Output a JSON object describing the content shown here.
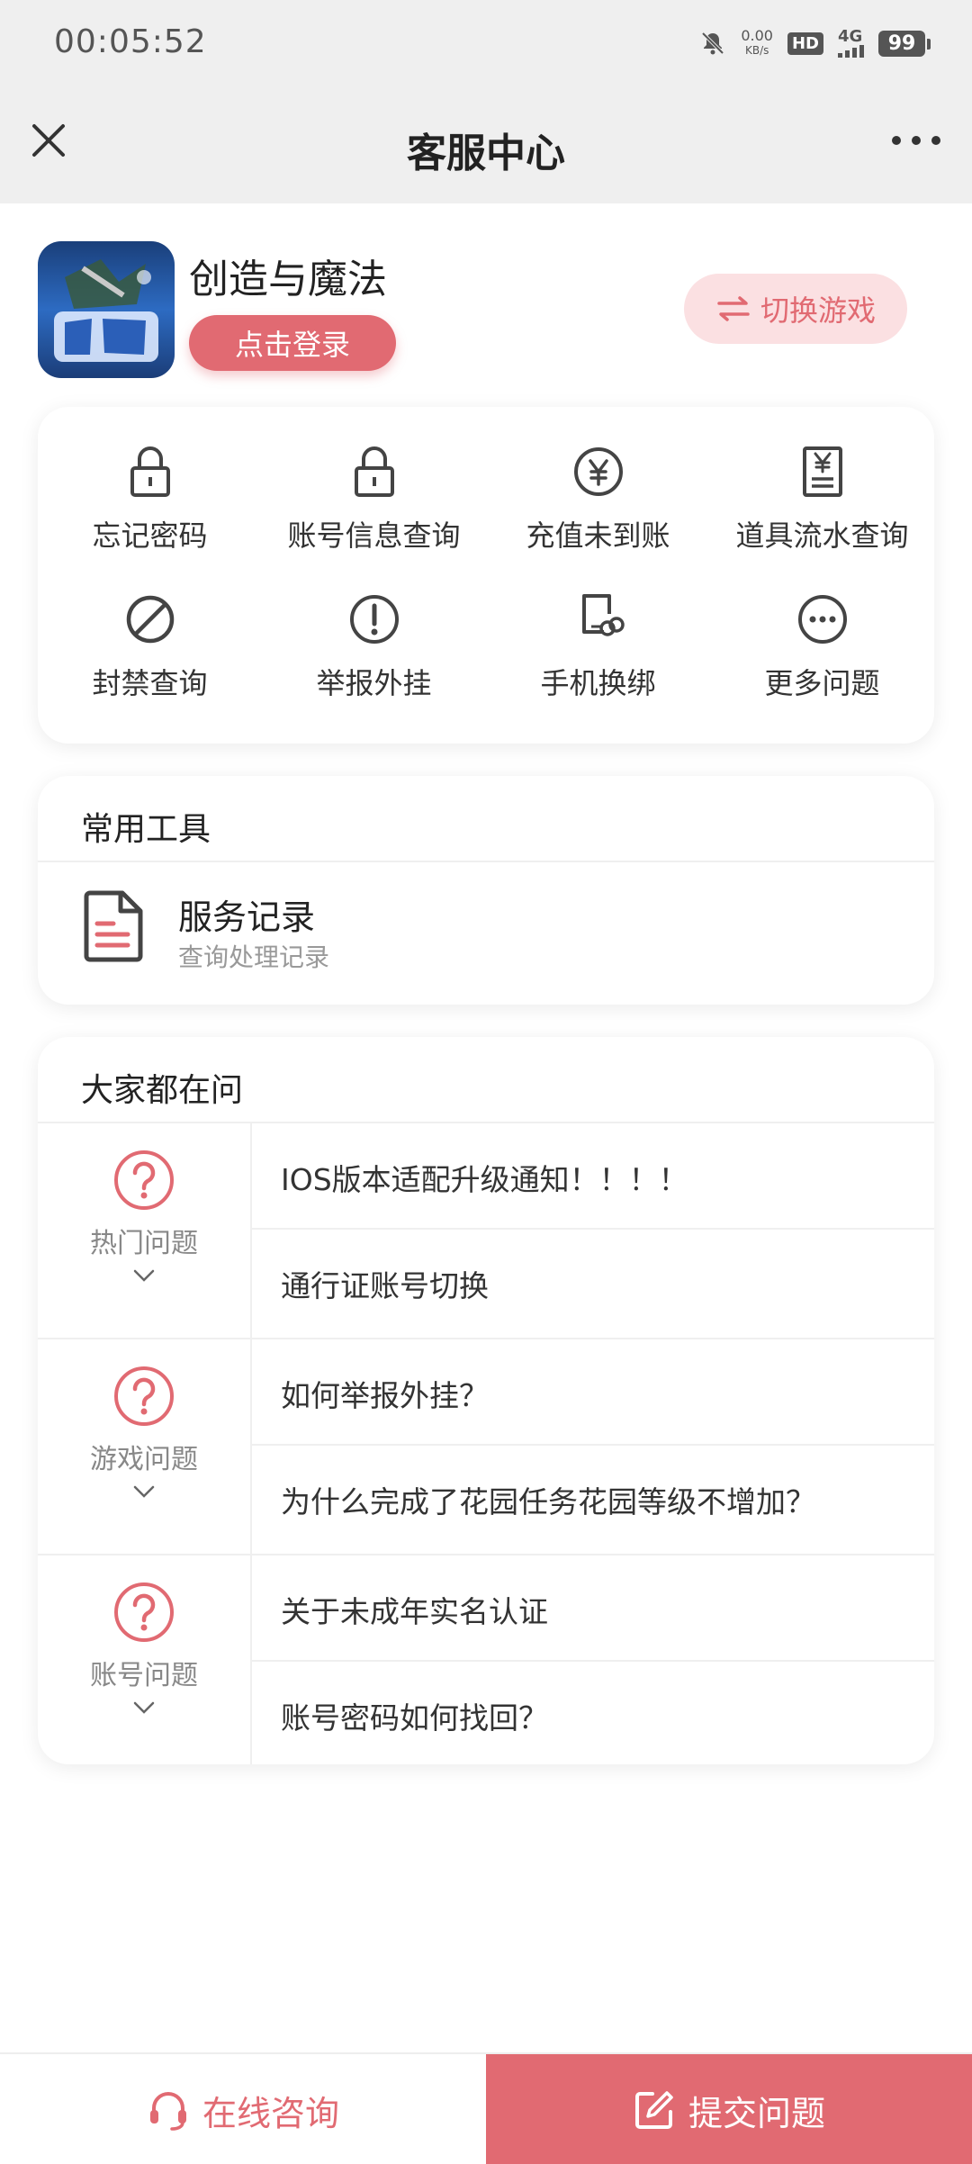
{
  "status_bar": {
    "time": "00:05:52",
    "net_speed_value": "0.00",
    "net_speed_unit": "KB/s",
    "hd_label": "HD",
    "network_label": "4G",
    "battery": "99"
  },
  "header": {
    "title": "客服中心"
  },
  "game": {
    "name": "创造与魔法",
    "login_label": "点击登录",
    "switch_label": "切换游戏"
  },
  "quick_actions": [
    {
      "label": "忘记密码",
      "icon": "lock-icon"
    },
    {
      "label": "账号信息查询",
      "icon": "lock-icon"
    },
    {
      "label": "充值未到账",
      "icon": "yen-circle-icon"
    },
    {
      "label": "道具流水查询",
      "icon": "yen-receipt-icon"
    },
    {
      "label": "封禁查询",
      "icon": "ban-icon"
    },
    {
      "label": "举报外挂",
      "icon": "alert-icon"
    },
    {
      "label": "手机换绑",
      "icon": "phone-link-icon"
    },
    {
      "label": "更多问题",
      "icon": "more-circle-icon"
    }
  ],
  "tools": {
    "title": "常用工具",
    "items": [
      {
        "title": "服务记录",
        "subtitle": "查询处理记录",
        "icon": "document-icon"
      }
    ]
  },
  "faq": {
    "title": "大家都在问",
    "groups": [
      {
        "category": "热门问题",
        "questions": [
          "IOS版本适配升级通知！！！！",
          "通行证账号切换"
        ]
      },
      {
        "category": "游戏问题",
        "questions": [
          "如何举报外挂？",
          "为什么完成了花园任务花园等级不增加？"
        ]
      },
      {
        "category": "账号问题",
        "questions": [
          "关于未成年实名认证",
          "账号密码如何找回？"
        ]
      }
    ]
  },
  "bottom_bar": {
    "consult_label": "在线咨询",
    "submit_label": "提交问题"
  },
  "colors": {
    "accent": "#e16a72",
    "accent_light": "#fbe0e2",
    "header_bg": "#efefef"
  }
}
